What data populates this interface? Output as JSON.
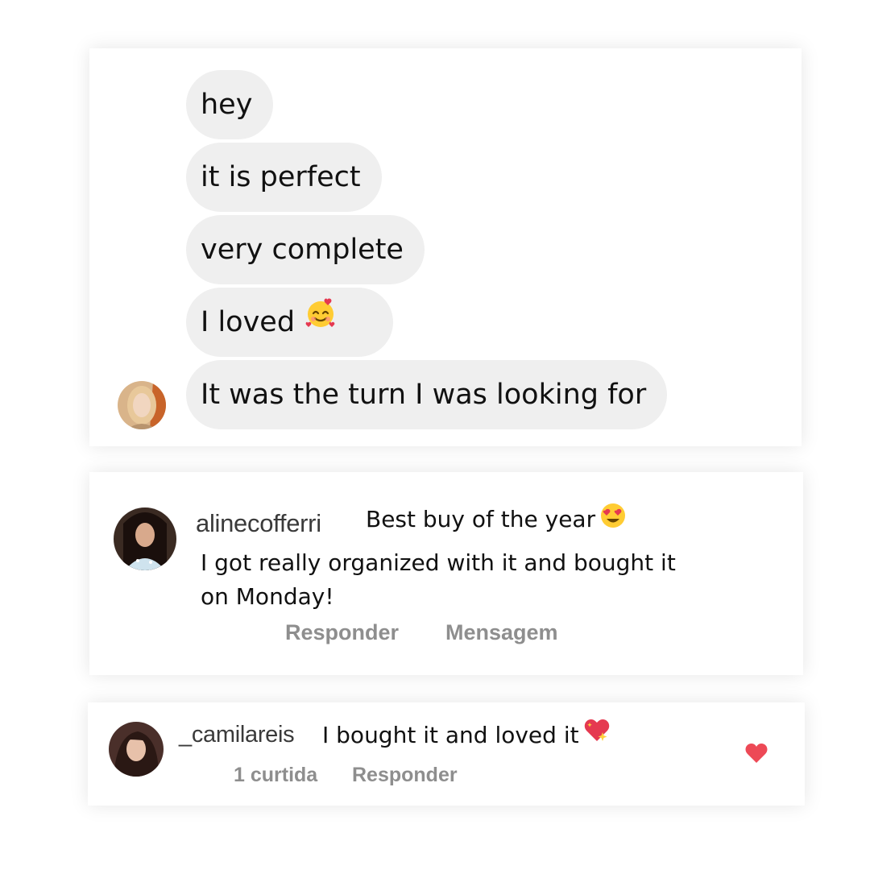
{
  "chat": {
    "messages": [
      {
        "text": "hey"
      },
      {
        "text": "it is perfect"
      },
      {
        "text": "very complete"
      },
      {
        "text": "I loved",
        "emoji": "smiling-face-with-hearts-icon"
      },
      {
        "text": "It was the turn I was looking for"
      }
    ]
  },
  "comments": [
    {
      "username": "alinecofferri",
      "text_line1": "Best buy of the year",
      "emoji": "heart-eyes-icon",
      "text_line2": "I got really organized with it and bought it",
      "text_line3": "on Monday!",
      "actions": {
        "reply": "Responder",
        "message": "Mensagem"
      }
    },
    {
      "username": "_camilareis",
      "text": "I bought it and loved it",
      "emoji": "sparkling-heart-icon",
      "likes": "1 curtida",
      "actions": {
        "reply": "Responder"
      },
      "liked": true
    }
  ],
  "colors": {
    "bubble": "#efefef",
    "action_gray": "#8e8e8e",
    "like_red": "#ed4956"
  }
}
